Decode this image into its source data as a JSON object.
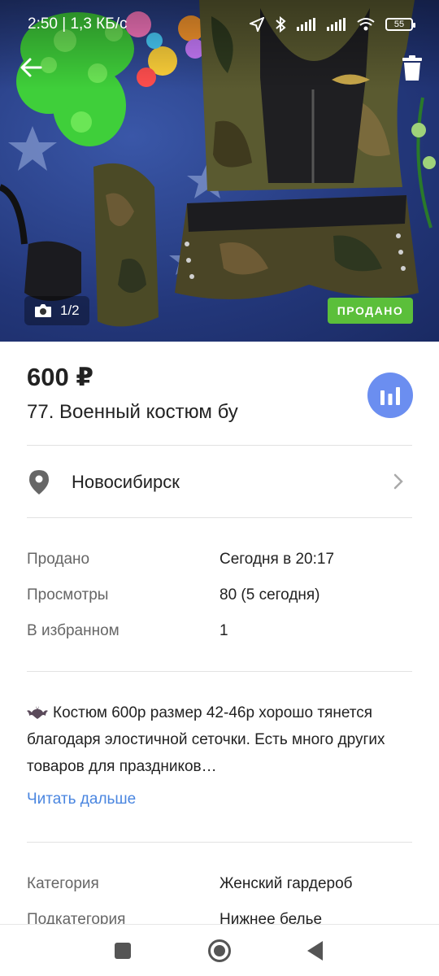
{
  "status_bar": {
    "time": "2:50",
    "speed": "1,3 КБ/с",
    "battery": "55",
    "icons": [
      "location-icon",
      "bluetooth-icon",
      "signal-icon",
      "signal-icon",
      "wifi-icon",
      "battery-icon"
    ]
  },
  "photo": {
    "counter": "1/2",
    "sold_badge": "ПРОДАНО"
  },
  "listing": {
    "price": "600 ₽",
    "title": "77. Военный костюм бу",
    "city": "Новосибирск"
  },
  "info": {
    "rows": [
      {
        "label": "Продано",
        "value": "Сегодня в 20:17"
      },
      {
        "label": "Просмотры",
        "value": "80 (5 сегодня)"
      },
      {
        "label": "В избранном",
        "value": "1"
      }
    ]
  },
  "description": {
    "text": "Костюм 600р размер 42-46р хорошо тянется благодаря элостичной сеточки. Есть много других товаров для праздников…",
    "read_more": "Читать дальше"
  },
  "details": {
    "rows": [
      {
        "label": "Категория",
        "value": "Женский гардероб"
      },
      {
        "label": "Подкатегория",
        "value": "Нижнее белье"
      }
    ]
  },
  "colors": {
    "accent_blue": "#6b8ef0",
    "link_blue": "#4a86e0",
    "sold_green": "#5bbf3a"
  }
}
